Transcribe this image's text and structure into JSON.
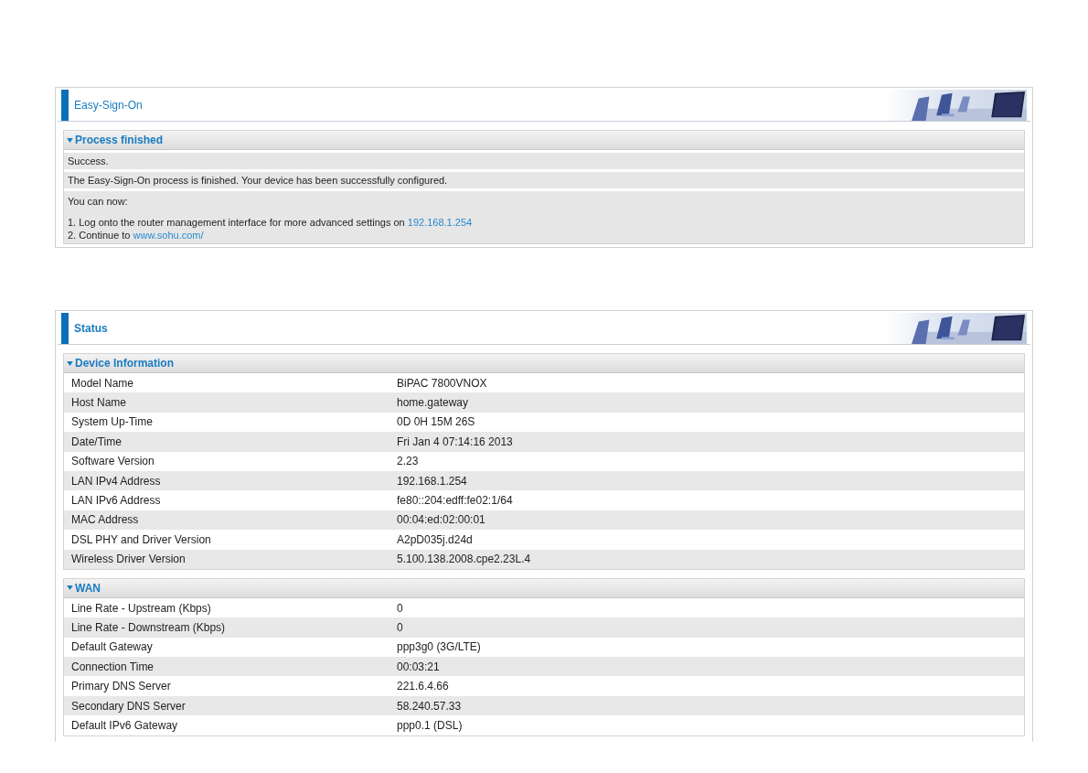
{
  "panels": [
    {
      "title": "Easy-Sign-On",
      "sections": [
        {
          "kind": "message",
          "title": "Process finished",
          "expanded": true,
          "lines": [
            {
              "kind": "plain",
              "text": "Success."
            },
            {
              "kind": "plain",
              "text": "The Easy-Sign-On process is finished. Your device has been successfully configured."
            },
            {
              "kind": "list",
              "text": "You can now:",
              "items": [
                {
                  "text": "1. Log onto the router management interface for more advanced settings on",
                  "link": "192.168.1.254"
                },
                {
                  "text": "2. Continue to",
                  "link": "www.sohu.com/"
                }
              ]
            }
          ]
        }
      ]
    },
    {
      "title": "Status",
      "sections": [
        {
          "kind": "table",
          "title": "Device Information",
          "expanded": true,
          "rows": [
            {
              "label": "Model Name",
              "value": "BiPAC 7800VNOX"
            },
            {
              "label": "Host Name",
              "value": "home.gateway"
            },
            {
              "label": "System Up-Time",
              "value": "0D 0H 15M 26S"
            },
            {
              "label": "Date/Time",
              "value": "Fri Jan 4 07:14:16 2013"
            },
            {
              "label": "Software Version",
              "value": "2.23"
            },
            {
              "label": "LAN IPv4 Address",
              "value": "192.168.1.254"
            },
            {
              "label": "LAN IPv6 Address",
              "value": "fe80::204:edff:fe02:1/64"
            },
            {
              "label": "MAC Address",
              "value": "00:04:ed:02:00:01"
            },
            {
              "label": "DSL PHY and Driver Version",
              "value": "A2pD035j.d24d"
            },
            {
              "label": "Wireless Driver Version",
              "value": "5.100.138.2008.cpe2.23L.4"
            }
          ]
        },
        {
          "kind": "table",
          "title": "WAN",
          "expanded": true,
          "rows": [
            {
              "label": "Line Rate - Upstream (Kbps)",
              "value": "0"
            },
            {
              "label": "Line Rate - Downstream (Kbps)",
              "value": "0"
            },
            {
              "label": "Default Gateway",
              "value": "ppp3g0 (3G/LTE)"
            },
            {
              "label": "Connection Time",
              "value": "00:03:21"
            },
            {
              "label": "Primary DNS Server",
              "value": "221.6.4.66"
            },
            {
              "label": "Secondary DNS Server",
              "value": "58.240.57.33"
            },
            {
              "label": "Default IPv6 Gateway",
              "value": "ppp0.1 (DSL)"
            }
          ]
        }
      ]
    }
  ]
}
